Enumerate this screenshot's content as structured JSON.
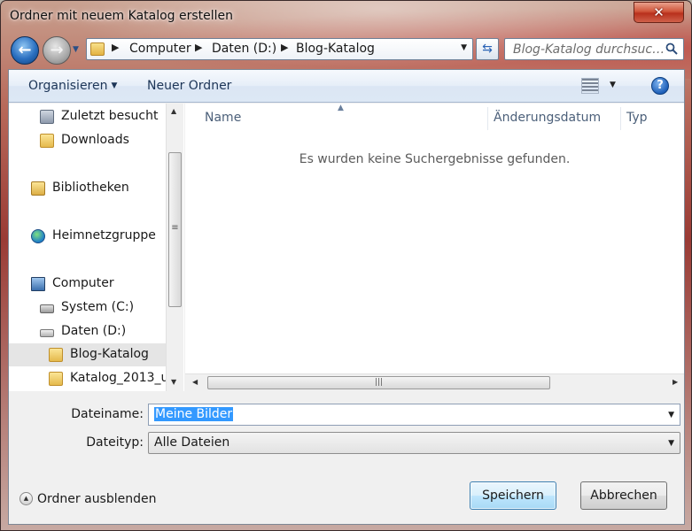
{
  "window": {
    "title": "Ordner mit neuem Katalog erstellen",
    "close_glyph": "✕"
  },
  "nav": {
    "back_glyph": "←",
    "forward_glyph": "→",
    "breadcrumbs": [
      "Computer",
      "Daten (D:)",
      "Blog-Katalog"
    ],
    "separator_glyph": "▶",
    "search_placeholder": "Blog-Katalog durchsuc…"
  },
  "toolbar": {
    "organize_label": "Organisieren",
    "new_folder_label": "Neuer Ordner",
    "help_glyph": "?"
  },
  "sidebar": {
    "items": [
      {
        "label": "Zuletzt besucht",
        "icon": "recent-places-icon"
      },
      {
        "label": "Downloads",
        "icon": "folder-icon"
      },
      {
        "label": "Bibliotheken",
        "icon": "libraries-icon"
      },
      {
        "label": "Heimnetzgruppe",
        "icon": "homegroup-icon"
      },
      {
        "label": "Computer",
        "icon": "computer-icon"
      },
      {
        "label": "System (C:)",
        "icon": "drive-icon"
      },
      {
        "label": "Daten (D:)",
        "icon": "drive-icon"
      },
      {
        "label": "Blog-Katalog",
        "icon": "folder-icon",
        "selected": true
      },
      {
        "label": "Katalog_2013_u",
        "icon": "folder-icon"
      }
    ]
  },
  "file_list": {
    "columns": [
      "Name",
      "Änderungsdatum",
      "Typ"
    ],
    "empty_message": "Es wurden keine Suchergebnisse gefunden."
  },
  "form": {
    "filename_label": "Dateiname:",
    "filename_value": "Meine Bilder",
    "filetype_label": "Dateityp:",
    "filetype_value": "Alle Dateien"
  },
  "footer": {
    "hide_folders_label": "Ordner ausblenden",
    "save_label": "Speichern",
    "cancel_label": "Abbrechen"
  },
  "colors": {
    "selection": "#3399ff",
    "close_button": "#c7432b",
    "command_bar": "#dde8f5"
  }
}
